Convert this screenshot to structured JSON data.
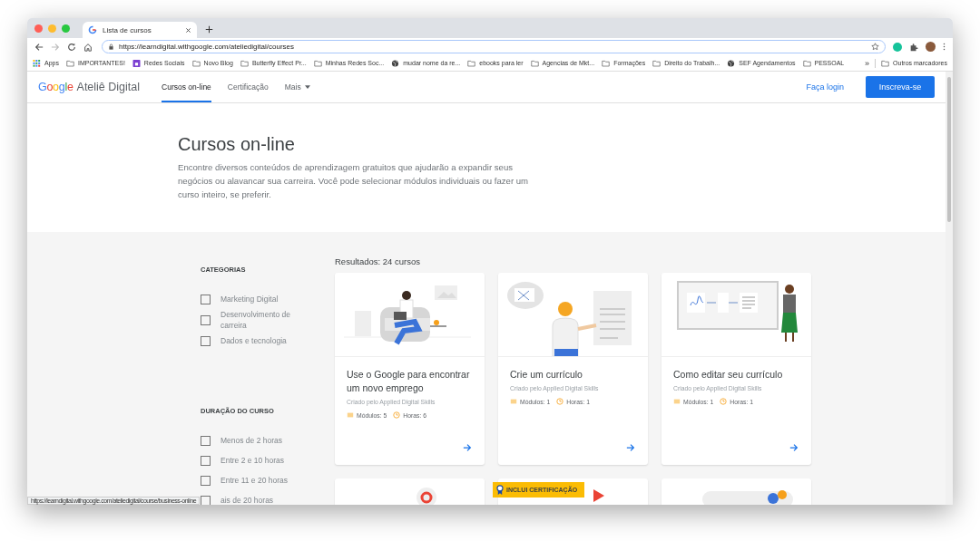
{
  "browser": {
    "tab_title": "Lista de cursos",
    "url": "https://learndigital.withgoogle.com/ateliedigital/courses",
    "bookmarks": [
      {
        "kind": "apps",
        "label": "Apps"
      },
      {
        "kind": "folder",
        "label": "IMPORTANTES!"
      },
      {
        "kind": "purple",
        "label": "Redes Sociais"
      },
      {
        "kind": "folder",
        "label": "Novo Blog"
      },
      {
        "kind": "folder",
        "label": "Butterfly Effect Pr..."
      },
      {
        "kind": "folder",
        "label": "Minhas Redes Soc..."
      },
      {
        "kind": "globe",
        "label": "mudar nome da re..."
      },
      {
        "kind": "folder",
        "label": "ebooks para ler"
      },
      {
        "kind": "folder",
        "label": "Agencias de Mkt..."
      },
      {
        "kind": "folder",
        "label": "Formações"
      },
      {
        "kind": "folder",
        "label": "Direito do Trabalh..."
      },
      {
        "kind": "globe",
        "label": "SEF Agendamentos"
      },
      {
        "kind": "folder",
        "label": "PESSOAL"
      }
    ],
    "more_bookmarks": "»",
    "other_bookmarks": "Outros marcadores",
    "status_url": "https://learndigital.withgoogle.com/ateliedigital/course/business-online"
  },
  "site": {
    "logo_brand": "Google",
    "logo_name": "Ateliê Digital",
    "nav": [
      {
        "label": "Cursos on-line",
        "selected": true,
        "dropdown": false
      },
      {
        "label": "Certificação",
        "selected": false,
        "dropdown": false
      },
      {
        "label": "Mais",
        "selected": false,
        "dropdown": true
      }
    ],
    "login": "Faça login",
    "signup": "Inscreva-se"
  },
  "hero": {
    "title": "Cursos on-line",
    "description": "Encontre diversos conteúdos de aprendizagem gratuitos que ajudarão a expandir seus negócios ou alavancar sua carreira. Você pode selecionar módulos individuais ou fazer um curso inteiro, se preferir."
  },
  "filters": [
    {
      "title": "CATEGORIAS",
      "options": [
        {
          "label": "Marketing Digital",
          "checked": false
        },
        {
          "label": "Desenvolvimento de carreira",
          "checked": false
        },
        {
          "label": "Dados e tecnologia",
          "checked": false
        }
      ]
    },
    {
      "title": "DURAÇÃO DO CURSO",
      "options": [
        {
          "label": "Menos de 2 horas",
          "checked": false
        },
        {
          "label": "Entre 2 e 10 horas",
          "checked": false
        },
        {
          "label": "Entre 11 e 20 horas",
          "checked": false
        },
        {
          "label": "ais de 20 horas",
          "checked": false
        }
      ]
    }
  ],
  "results": "Resultados: 24 cursos",
  "courses": [
    {
      "title": "Use o Google para encontrar um novo emprego",
      "author": "Criado pelo Applied Digital Skills",
      "modules": "Módulos: 5",
      "hours": "Horas: 6"
    },
    {
      "title": "Crie um currículo",
      "author": "Criado pelo Applied Digital Skills",
      "modules": "Módulos: 1",
      "hours": "Horas: 1"
    },
    {
      "title": "Como editar seu currículo",
      "author": "Criado pelo Applied Digital Skills",
      "modules": "Módulos: 1",
      "hours": "Horas: 1"
    }
  ],
  "more_courses": [
    {
      "certified": false
    },
    {
      "certified": true,
      "badge": "INCLUI CERTIFICAÇÃO"
    },
    {
      "certified": false
    }
  ]
}
